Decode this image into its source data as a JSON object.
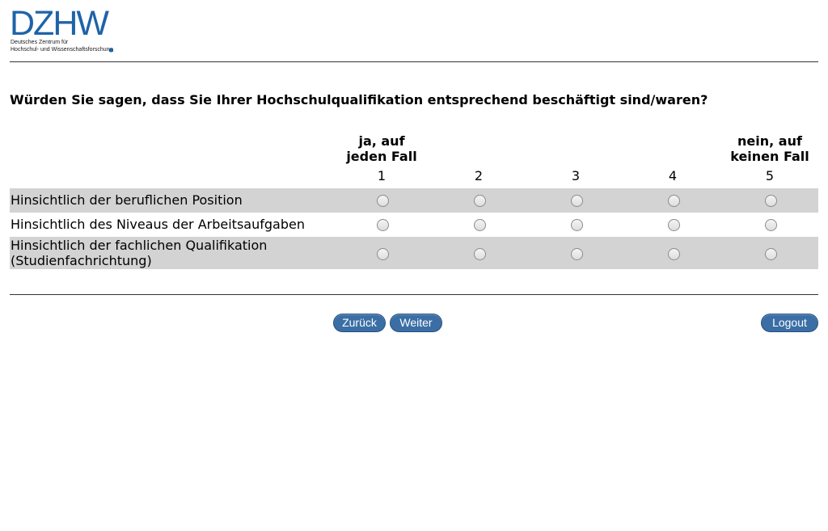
{
  "logo": {
    "wordmark": "DZHW",
    "subtitle_line1": "Deutsches Zentrum für",
    "subtitle_line2": "Hochschul- und Wissenschaftsforschung"
  },
  "question": "Würden Sie sagen, dass Sie Ihrer Hochschulqualifikation entsprechend beschäftigt sind/waren?",
  "scale": {
    "left_anchor_line1": "ja, auf",
    "left_anchor_line2": "jeden Fall",
    "right_anchor_line1": "nein, auf",
    "right_anchor_line2": "keinen Fall",
    "points": [
      "1",
      "2",
      "3",
      "4",
      "5"
    ]
  },
  "rows": [
    {
      "label_line1": "Hinsichtlich der beruflichen Position",
      "label_line2": ""
    },
    {
      "label_line1": "Hinsichtlich des Niveaus der Arbeitsaufgaben",
      "label_line2": ""
    },
    {
      "label_line1": "Hinsichtlich der fachlichen Qualifikation",
      "label_line2": "(Studienfachrichtung)"
    }
  ],
  "buttons": {
    "back": "Zurück",
    "next": "Weiter",
    "logout": "Logout"
  },
  "colors": {
    "brand": "#1f63a8",
    "row_shade": "#d3d3d3",
    "button": "#3b6ea5"
  }
}
